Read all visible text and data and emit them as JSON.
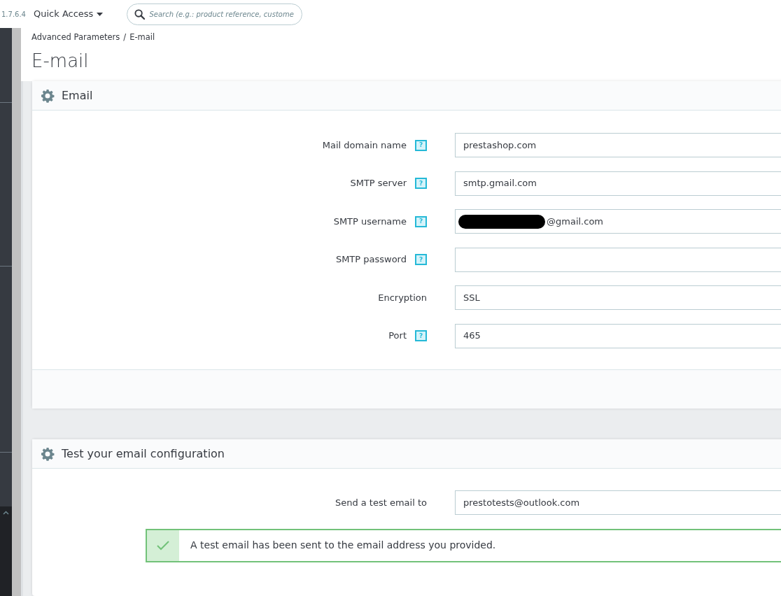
{
  "header": {
    "version": "1.7.6.4",
    "quick_access": "Quick Access",
    "search": {
      "placeholder": "Search (e.g.: product reference, custome"
    }
  },
  "breadcrumb": [
    "Advanced Parameters",
    "E-mail"
  ],
  "breadcrumb_separator": "/",
  "page_title": "E-mail",
  "email_panel": {
    "title": "Email",
    "fields": [
      {
        "label": "Mail domain name",
        "help": "?",
        "value": "prestashop.com"
      },
      {
        "label": "SMTP server",
        "help": "?",
        "value": "smtp.gmail.com"
      },
      {
        "label": "SMTP username",
        "help": "?",
        "value": "@gmail.com",
        "redacted": true
      },
      {
        "label": "SMTP password",
        "help": "?"
      },
      {
        "label": "Encryption",
        "value": "SSL"
      },
      {
        "label": "Port",
        "help": "?",
        "value": "465"
      }
    ]
  },
  "test_panel": {
    "title": "Test your email configuration",
    "fields": [
      {
        "label": "Send a test email to",
        "value": "prestotests@outlook.com"
      }
    ],
    "alert": {
      "kind": "success",
      "text": "A test email has been sent to the email address you provided."
    }
  }
}
